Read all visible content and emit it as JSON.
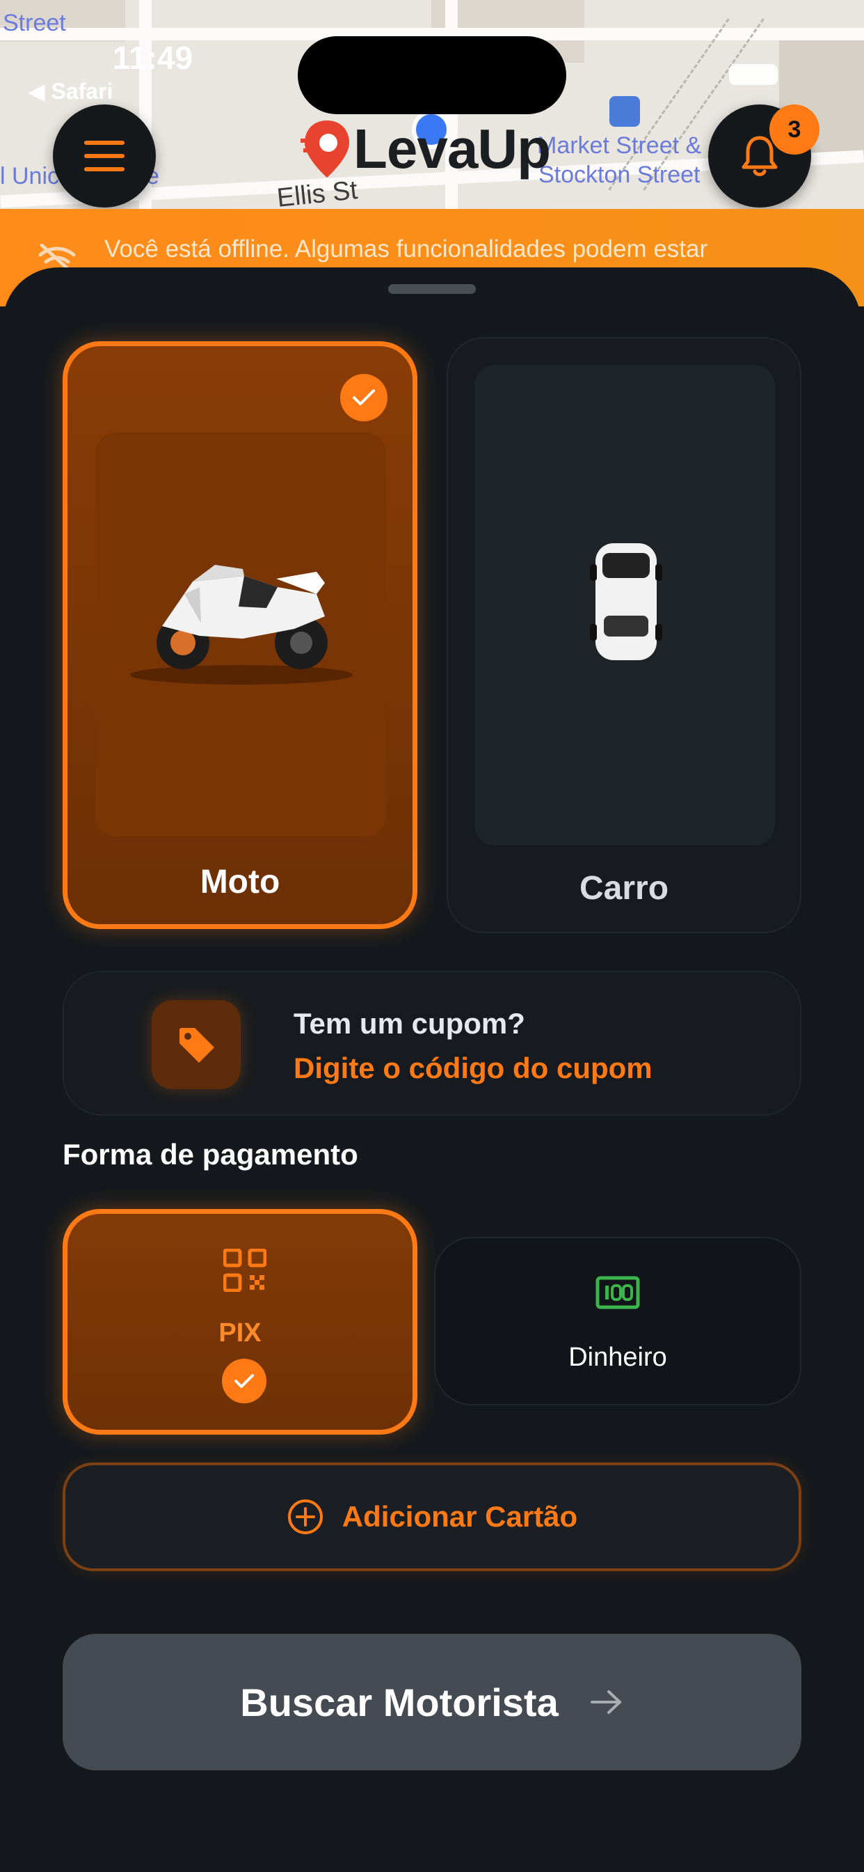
{
  "status_bar": {
    "time": "11:49",
    "back_app": "◀ Safari"
  },
  "map": {
    "labels": [
      "Street",
      "l Unic",
      "e",
      "Ellis St",
      "Market Street &",
      "Stockton Street"
    ]
  },
  "header": {
    "logo_text": "LevaUp",
    "notification_count": "3"
  },
  "offline_banner": {
    "text": "Você está offline. Algumas funcionalidades podem estar"
  },
  "vehicles": [
    {
      "label": "Moto",
      "selected": true
    },
    {
      "label": "Carro",
      "selected": false
    }
  ],
  "coupon": {
    "title": "Tem um cupom?",
    "subtitle": "Digite o código do cupom"
  },
  "payment": {
    "title": "Forma de pagamento",
    "methods": [
      {
        "label": "PIX",
        "selected": true
      },
      {
        "label": "Dinheiro",
        "selected": false
      }
    ],
    "add_card_label": "Adicionar Cartão"
  },
  "search_button_label": "Buscar Motorista",
  "colors": {
    "accent": "#ff7a14",
    "background": "#15191d",
    "cash_green": "#3bb54a"
  }
}
